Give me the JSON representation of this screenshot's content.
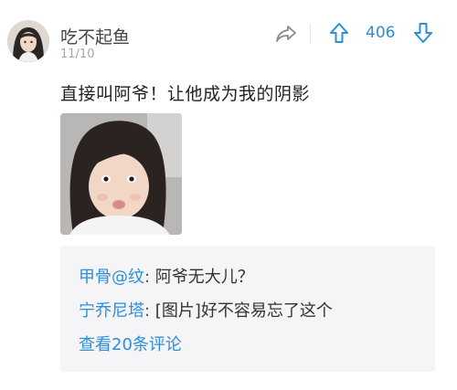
{
  "comment": {
    "username": "吃不起鱼",
    "date": "11/10",
    "text": "直接叫阿爷！让他成为我的阴影",
    "vote_count": "406"
  },
  "replies": [
    {
      "name": "甲骨@纹",
      "colon": ":",
      "text": " 阿爷无大儿？"
    },
    {
      "name": "宁乔尼塔",
      "colon": ":",
      "text": " [图片]好不容易忘了这个"
    }
  ],
  "view_more_label": "查看20条评论",
  "colors": {
    "accent": "#2a8fd8",
    "reply_bg": "#f5f5f7",
    "date": "#a6a6a6"
  },
  "icons": {
    "share": "share-arrow-icon",
    "upvote": "arrow-up-icon",
    "downvote": "arrow-down-icon"
  }
}
